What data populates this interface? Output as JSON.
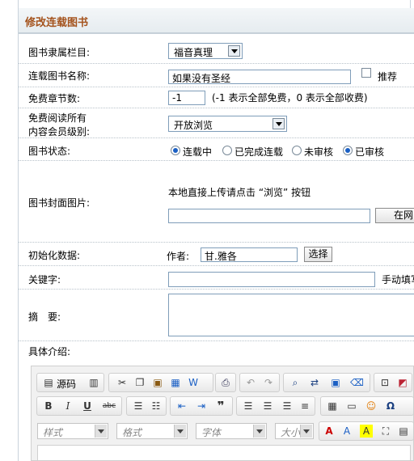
{
  "header": {
    "title": "修改连载图书"
  },
  "fields": {
    "category": {
      "label": "图书隶属栏目:",
      "value": "福音真理"
    },
    "name": {
      "label": "连载图书名称:",
      "value": "如果没有圣经",
      "recommend": "推荐"
    },
    "free_chapters": {
      "label": "免费章节数:",
      "value": "-1",
      "hint": "(-1 表示全部免费，0 表示全部收费)"
    },
    "member_level": {
      "label_line1": "免费阅读所有",
      "label_line2": "内容会员级别:",
      "value": "开放浏览"
    },
    "status": {
      "label": "图书状态:",
      "options": [
        "连载中",
        "已完成连载",
        "未审核",
        "已审核"
      ]
    },
    "cover": {
      "label": "图书封面图片:",
      "hint": "本地直接上传请点击 “浏览” 按钮",
      "button": "在网"
    },
    "init": {
      "label": "初始化数据:",
      "author_label": "作者:",
      "author_value": "甘.雅各",
      "select_button": "选择"
    },
    "keywords": {
      "label": "关键字:",
      "hint": "手动填写"
    },
    "summary": {
      "label": "摘　要:"
    },
    "intro": {
      "label": "具体介绍:"
    }
  },
  "editor": {
    "source_label": "源码",
    "combos": [
      "样式",
      "格式",
      "字体",
      "大小"
    ],
    "toolbar_icons": [
      "source-icon",
      "template-icon",
      "cut-icon",
      "copy-icon",
      "paste-icon",
      "paste-text-icon",
      "paste-word-icon",
      "print-icon",
      "undo-icon",
      "redo-icon",
      "find-icon",
      "replace-icon",
      "select-all-icon",
      "remove-format-icon",
      "preview-icon",
      "flash-icon",
      "bold-icon",
      "italic-icon",
      "underline-icon",
      "strike-icon",
      "ordered-list-icon",
      "bullet-list-icon",
      "outdent-icon",
      "indent-icon",
      "blockquote-icon",
      "align-left-icon",
      "align-center-icon",
      "align-right-icon",
      "justify-icon",
      "table-icon",
      "hr-icon",
      "smiley-icon",
      "special-char-icon"
    ]
  }
}
